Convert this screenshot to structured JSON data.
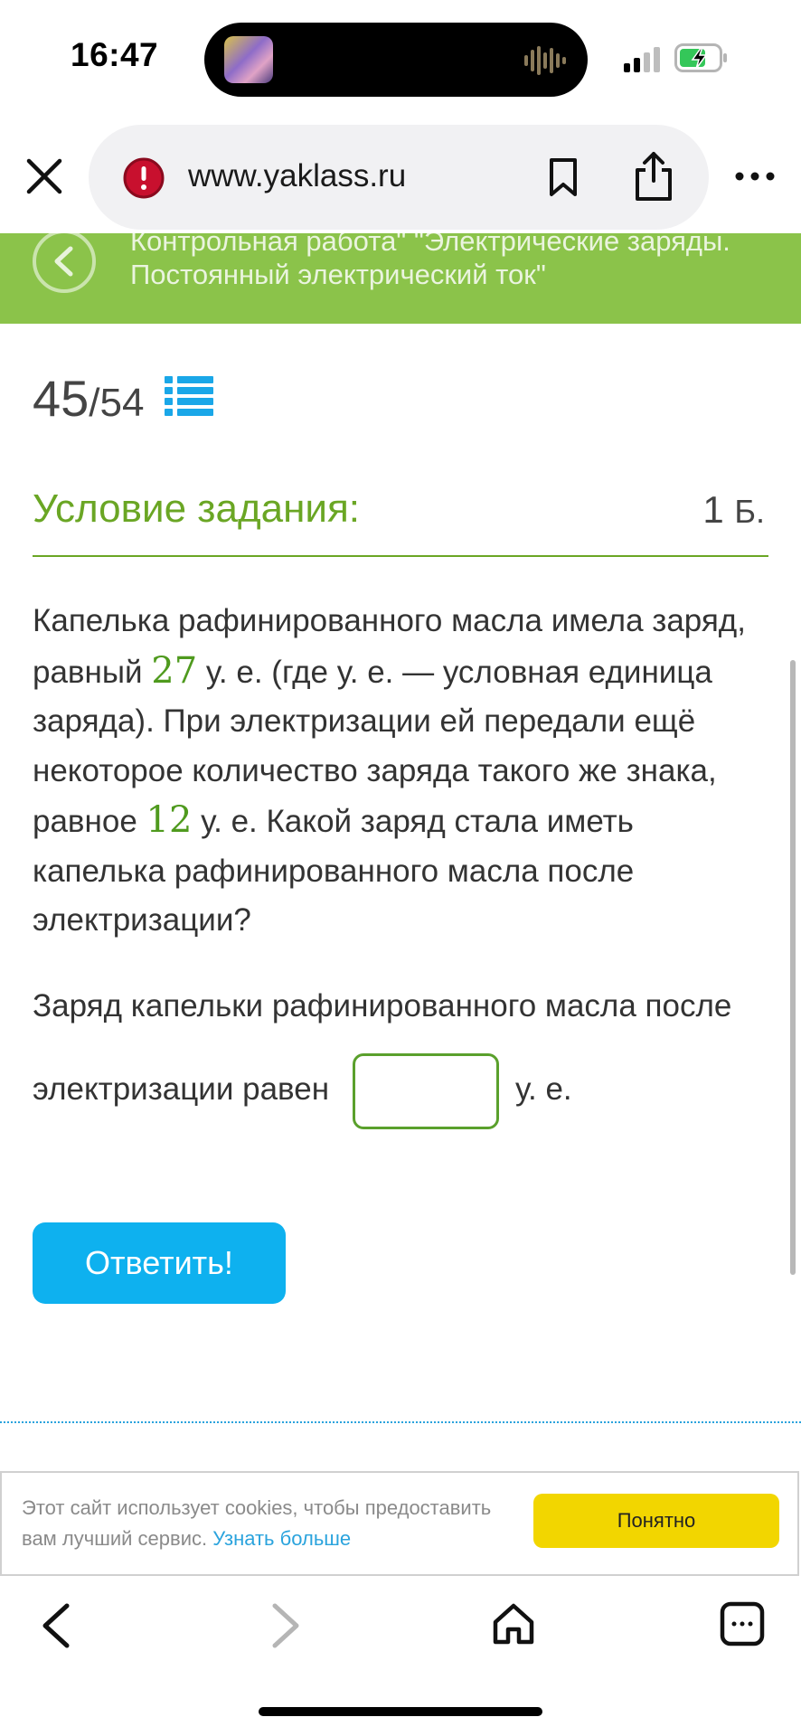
{
  "status_bar": {
    "time": "16:47",
    "battery_state": "charging"
  },
  "browser": {
    "url": "www.yaklass.ru"
  },
  "header": {
    "title": "Контрольная работа\" \"Электрические заряды.\nПостоянный электрический ток\""
  },
  "progress": {
    "current": "45",
    "separator": "/",
    "total": "54"
  },
  "condition": {
    "title": "Условие задания:",
    "points": "1",
    "points_unit": "Б.",
    "text_1": "Капелька рафинированного масла имела заряд, равный ",
    "value_1": "27",
    "text_2": " у. е. (где у. е. — условная единица заряда). При электризации ей передали ещё некоторое количество заряда такого же знака, равное ",
    "value_2": "12",
    "text_3": " у. е. Какой заряд стала иметь капелька рафинированного масла после электризации?"
  },
  "answer": {
    "line1": "Заряд капельки рафинированного масла после",
    "line2": "электризации равен",
    "input_value": "",
    "unit": "у. е."
  },
  "submit_label": "Ответить!",
  "cookie": {
    "text": "Этот сайт использует cookies, чтобы предоставить вам лучший сервис.",
    "link": "Узнать больше",
    "button": "Понятно"
  },
  "colors": {
    "accent_green": "#8bc34a",
    "text_green": "#6aa624",
    "button_blue": "#0eb1ef",
    "cookie_yellow": "#f2d600"
  },
  "icons": [
    "close-icon",
    "warning-icon",
    "bookmark-icon",
    "share-icon",
    "more-icon",
    "back-chevron-icon",
    "list-icon",
    "nav-back-icon",
    "nav-forward-icon",
    "home-icon",
    "tabs-icon"
  ]
}
